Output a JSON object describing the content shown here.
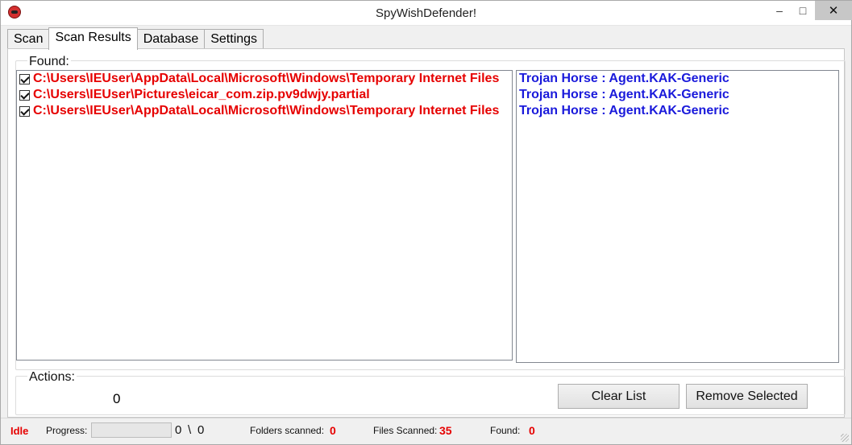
{
  "window": {
    "title": "SpyWishDefender!",
    "minimize_glyph": "–",
    "maximize_glyph": "□",
    "close_glyph": "✕"
  },
  "tabs": [
    {
      "label": "Scan",
      "active": false
    },
    {
      "label": "Scan Results",
      "active": true
    },
    {
      "label": "Database",
      "active": false
    },
    {
      "label": "Settings",
      "active": false
    }
  ],
  "found": {
    "label": "Found:",
    "files": [
      {
        "path": "C:\\Users\\IEUser\\AppData\\Local\\Microsoft\\Windows\\Temporary Internet Files",
        "checked": true
      },
      {
        "path": "C:\\Users\\IEUser\\Pictures\\eicar_com.zip.pv9dwjy.partial",
        "checked": true
      },
      {
        "path": "C:\\Users\\IEUser\\AppData\\Local\\Microsoft\\Windows\\Temporary Internet Files",
        "checked": true
      }
    ],
    "threats": [
      "Trojan Horse : Agent.KAK-Generic",
      "Trojan Horse : Agent.KAK-Generic",
      "Trojan Horse : Agent.KAK-Generic"
    ]
  },
  "actions": {
    "label": "Actions:",
    "count": "0",
    "clear_label": "Clear List",
    "remove_label": "Remove Selected"
  },
  "status": {
    "state": "Idle",
    "progress_label": "Progress:",
    "progress_fraction": 0,
    "progress_count": "0",
    "progress_sep": "\\",
    "progress_total": "0",
    "folders_label": "Folders scanned:",
    "folders_value": "0",
    "files_label": "Files Scanned:",
    "files_value": "35",
    "found_label": "Found:",
    "found_value": "0"
  },
  "colors": {
    "file_text": "#e60000",
    "threat_text": "#1a1adb",
    "status_value": "#e60000"
  },
  "icons": {
    "app": "defender-app-icon"
  }
}
